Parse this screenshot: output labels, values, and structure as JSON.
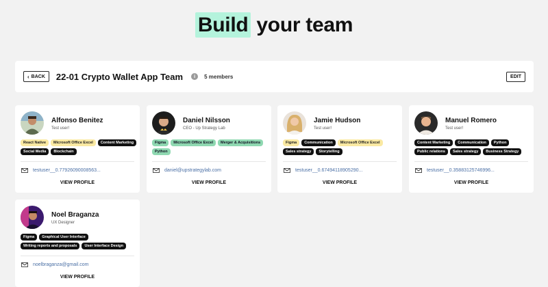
{
  "hero": {
    "highlight": "Build",
    "rest": " your team"
  },
  "team": {
    "back_label": "BACK",
    "title": "22-01 Crypto Wallet App Team",
    "info_icon": "info-icon",
    "members": "5 members",
    "edit_label": "EDIT"
  },
  "colors": {
    "yellow": "#fae9a2",
    "green": "#8fd8b1",
    "black": "#111111",
    "highlight": "#b4f3dc",
    "link": "#4a6fa5"
  },
  "cards": [
    {
      "name": "Alfonso Benitez",
      "role": "Test user!",
      "tags": [
        {
          "label": "React Native",
          "color": "yellow"
        },
        {
          "label": "Microsoft Office Excel",
          "color": "yellow"
        },
        {
          "label": "Content Marketing",
          "color": "black"
        },
        {
          "label": "Social Media",
          "color": "black"
        },
        {
          "label": "Blockchain",
          "color": "black"
        }
      ],
      "email": "testuser__0.77926090008563...",
      "view_label": "VIEW PROFILE"
    },
    {
      "name": "Daniel Nilsson",
      "role": "CEO - Up Strategy Lab",
      "tags": [
        {
          "label": "Figma",
          "color": "green"
        },
        {
          "label": "Microsoft Office Excel",
          "color": "green"
        },
        {
          "label": "Merger & Acquisitions",
          "color": "green"
        },
        {
          "label": "Python",
          "color": "green"
        }
      ],
      "email": "daniel@upstrategylab.com",
      "view_label": "VIEW PROFILE"
    },
    {
      "name": "Jamie Hudson",
      "role": "Test user!",
      "tags": [
        {
          "label": "Figma",
          "color": "yellow"
        },
        {
          "label": "Communication",
          "color": "black"
        },
        {
          "label": "Microsoft Office Excel",
          "color": "yellow"
        },
        {
          "label": "Sales strategy",
          "color": "black"
        },
        {
          "label": "Storytelling",
          "color": "black"
        }
      ],
      "email": "testuser__0.67494118905290...",
      "view_label": "VIEW PROFILE"
    },
    {
      "name": "Manuel Romero",
      "role": "Test user!",
      "tags": [
        {
          "label": "Content Marketing",
          "color": "black"
        },
        {
          "label": "Communication",
          "color": "black"
        },
        {
          "label": "Python",
          "color": "black"
        },
        {
          "label": "Public relations",
          "color": "black"
        },
        {
          "label": "Sales strategy",
          "color": "black"
        },
        {
          "label": "Business Strategy",
          "color": "black"
        }
      ],
      "email": "testuser__0.35883125746996...",
      "view_label": "VIEW PROFILE"
    },
    {
      "name": "Noel Braganza",
      "role": "UX Designer",
      "tags": [
        {
          "label": "Figma",
          "color": "black"
        },
        {
          "label": "Graphical User Interface",
          "color": "black"
        },
        {
          "label": "Writing reports and proposals",
          "color": "black"
        },
        {
          "label": "User Interface Design",
          "color": "black"
        }
      ],
      "email": "noelbraganza@gmail.com",
      "view_label": "VIEW PROFILE"
    }
  ]
}
